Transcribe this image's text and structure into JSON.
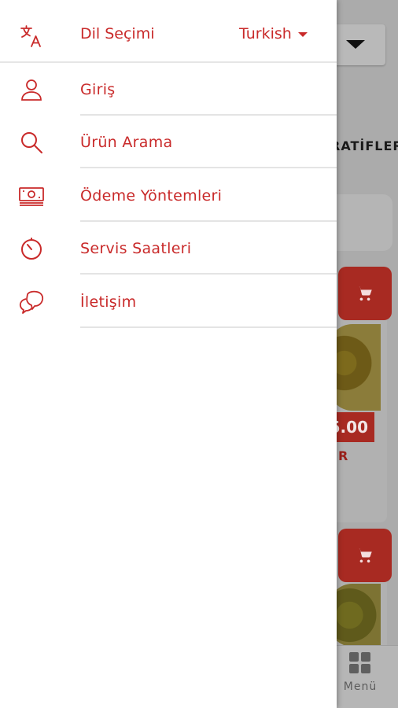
{
  "drawer": {
    "language": {
      "label": "Dil Seçimi",
      "selected": "Turkish",
      "icon": "translate-icon"
    },
    "items": [
      {
        "label": "Giriş",
        "icon": "user-icon"
      },
      {
        "label": "Ürün Arama",
        "icon": "search-icon"
      },
      {
        "label": "Ödeme Yöntemleri",
        "icon": "cash-icon"
      },
      {
        "label": "Servis Saatleri",
        "icon": "timer-icon"
      },
      {
        "label": "İletişim",
        "icon": "chat-icon"
      }
    ]
  },
  "background": {
    "tab_text": "RATİFLER",
    "price": "5.00",
    "price_sub": "R",
    "bottom_tab": "Menü"
  },
  "colors": {
    "accent": "#c92a2a",
    "button": "#a82a22"
  }
}
